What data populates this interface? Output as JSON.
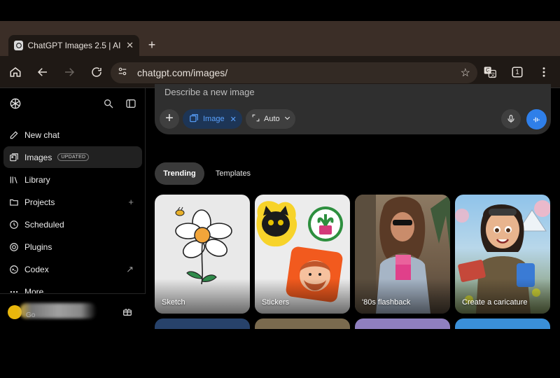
{
  "browser": {
    "tab_title": "ChatGPT Images 2.5 | AI Im",
    "tab_close": "✕",
    "new_tab": "+",
    "url": "chatgpt.com/images/",
    "tab_count": "1"
  },
  "sidebar": {
    "items": [
      {
        "label": "New chat",
        "icon": "edit-icon"
      },
      {
        "label": "Images",
        "icon": "images-icon",
        "badge": "UPDATED"
      },
      {
        "label": "Library",
        "icon": "library-icon"
      },
      {
        "label": "Projects",
        "icon": "folder-icon",
        "trailing": "+"
      },
      {
        "label": "Scheduled",
        "icon": "clock-icon"
      },
      {
        "label": "Plugins",
        "icon": "plugin-icon"
      },
      {
        "label": "Codex",
        "icon": "codex-icon",
        "trailing": "↗"
      },
      {
        "label": "More",
        "icon": "dots-icon"
      }
    ],
    "user_sub": "Go"
  },
  "composer": {
    "placeholder": "Describe a new image",
    "chip_image": "Image",
    "chip_auto": "Auto"
  },
  "tabs": {
    "trending": "Trending",
    "templates": "Templates"
  },
  "cards": [
    {
      "label": "Sketch"
    },
    {
      "label": "Stickers"
    },
    {
      "label": "'80s flashback"
    },
    {
      "label": "Create a caricature"
    }
  ],
  "colors": {
    "accent": "#2f7fe9",
    "image_chip": "#1d3556",
    "tabstrip": "#3b2e27"
  }
}
